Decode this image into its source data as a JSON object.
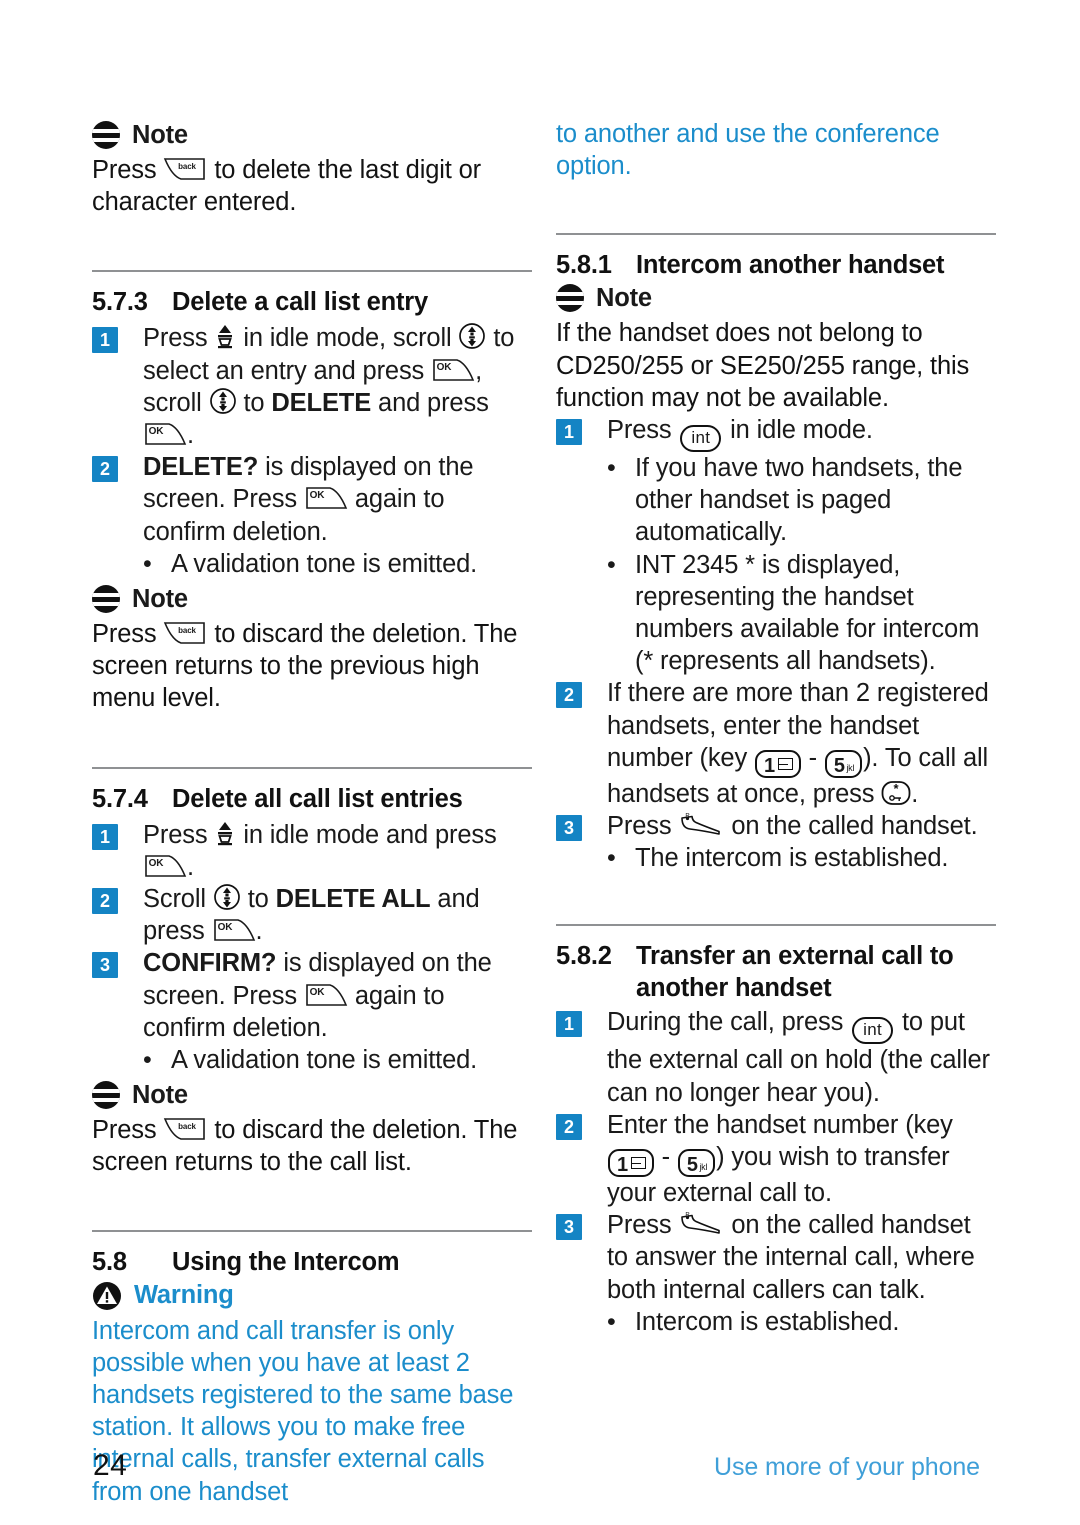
{
  "page": {
    "number": "24",
    "footer_note": "Use more of your phone",
    "accent_blue": "#1b8dcb",
    "badge_blue": "#1484c4"
  },
  "labels": {
    "note": "Note",
    "warning": "Warning"
  },
  "icons": {
    "note": "note-icon",
    "warning": "warning-triangle-icon",
    "back_key": "back-softkey-icon",
    "ok_key": "ok-softkey-icon",
    "call_list_key": "call-list-key-icon",
    "scroll_key": "scroll-up-down-key-icon",
    "int_key": "int-key-icon",
    "talk_key": "talk-key-icon",
    "key_1": "keypad-1-key-icon",
    "key_5": "keypad-5-key-icon",
    "key_star": "keypad-star-key-icon"
  },
  "left_column": {
    "note_1": {
      "label": "Note",
      "text_before": "Press",
      "text_after": "to delete the last digit or character entered."
    },
    "section_573": {
      "number": "5.7.3",
      "title": "Delete a call list entry",
      "steps": [
        {
          "num": "1",
          "parts": [
            "Press",
            "in idle mode, scroll",
            "to select an entry and press",
            ", scroll",
            "to",
            "DELETE",
            "and press",
            "."
          ]
        },
        {
          "num": "2",
          "bold_lead": "DELETE?",
          "parts": [
            "is displayed on the screen. Press",
            "again to confirm deletion."
          ]
        }
      ],
      "bullets": [
        "A validation tone is emitted."
      ]
    },
    "note_2": {
      "label": "Note",
      "text_before": "Press",
      "text_after": "to discard the deletion. The screen returns to the previous high menu level."
    },
    "section_574": {
      "number": "5.7.4",
      "title": "Delete all call list entries",
      "steps": [
        {
          "num": "1",
          "parts": [
            "Press",
            "in idle mode and press",
            "."
          ]
        },
        {
          "num": "2",
          "parts": [
            "Scroll",
            "to",
            "DELETE ALL",
            "and press",
            "."
          ]
        },
        {
          "num": "3",
          "bold_lead": "CONFIRM?",
          "parts": [
            "is displayed on the screen. Press",
            "again to confirm deletion."
          ]
        }
      ],
      "bullets": [
        "A validation tone is emitted."
      ]
    },
    "note_3": {
      "label": "Note",
      "text_before": "Press",
      "text_after": "to discard the deletion. The screen returns to the call list."
    },
    "section_58": {
      "number": "5.8",
      "title": "Using the Intercom"
    },
    "warning": {
      "label": "Warning",
      "text": "Intercom and call transfer is only possible when you have at least 2 handsets registered to the same base station. It allows you to make free internal calls, transfer external calls from one handset"
    }
  },
  "right_column": {
    "continued_text": "to another and use the conference option.",
    "section_581": {
      "number": "5.8.1",
      "title": "Intercom another handset",
      "note": {
        "label": "Note",
        "text": "If the handset does not belong to CD250/255 or SE250/255 range, this function may not be available."
      },
      "steps": [
        {
          "num": "1",
          "parts": [
            "Press",
            "in idle mode."
          ],
          "bullets": [
            "If you have two handsets, the other handset is paged automatically.",
            "INT 2345 * is displayed, representing the handset numbers available for intercom (* represents all handsets)."
          ]
        },
        {
          "num": "2",
          "parts": [
            "If there are more than 2 registered handsets, enter the handset number (key",
            "-",
            "). To call all handsets at once, press",
            "."
          ]
        },
        {
          "num": "3",
          "parts": [
            "Press",
            "on the called handset."
          ],
          "bullets": [
            "The intercom is established."
          ]
        }
      ]
    },
    "section_582": {
      "number": "5.8.2",
      "title_line1": "Transfer an external call to",
      "title_line2": "another handset",
      "steps": [
        {
          "num": "1",
          "parts": [
            "During the call, press",
            "to put the external call on hold (the caller can no longer hear you)."
          ]
        },
        {
          "num": "2",
          "parts": [
            "Enter the handset number (key",
            "-",
            ") you wish to transfer your external call to."
          ]
        },
        {
          "num": "3",
          "parts": [
            "Press",
            "on the called handset to answer the internal call, where both internal callers can talk."
          ],
          "bullets": [
            "Intercom is established."
          ]
        }
      ]
    }
  },
  "keypad": {
    "int_label": "int",
    "ok_label": "OK",
    "back_label": "back",
    "key1_digit": "1",
    "key5_digit": "5",
    "key5_sub": "jkl",
    "star_digit": "*"
  }
}
